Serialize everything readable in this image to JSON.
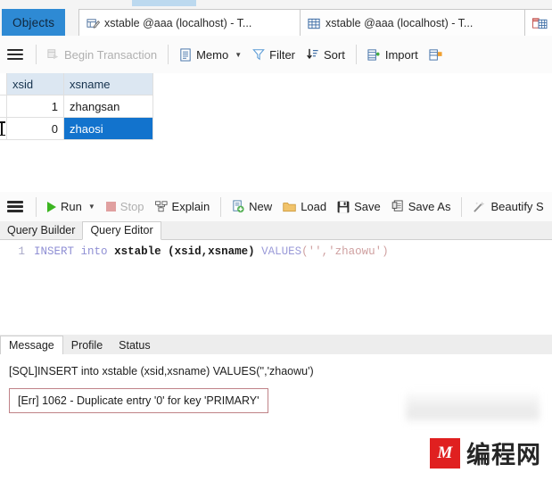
{
  "window_tabs": {
    "objects_label": "Objects",
    "tabs": [
      {
        "label": "xstable @aaa (localhost) - T...",
        "icon": "query-pencil-icon"
      },
      {
        "label": "xstable @aaa (localhost) - T...",
        "icon": "table-grid-icon"
      },
      {
        "label": "",
        "icon": "table-design-icon"
      }
    ]
  },
  "grid_toolbar": {
    "menu_icon": "hamburger-icon",
    "begin_transaction": "Begin Transaction",
    "memo": "Memo",
    "filter": "Filter",
    "sort": "Sort",
    "import": "Import"
  },
  "grid": {
    "columns": [
      "xsid",
      "xsname"
    ],
    "rows": [
      {
        "xsid": "1",
        "xsname": "zhangsan",
        "selected": false
      },
      {
        "xsid": "0",
        "xsname": "zhaosi",
        "selected": true
      }
    ],
    "selection_color": "#1273cd",
    "header_color": "#dce7f2"
  },
  "query_toolbar": {
    "menu_icon": "hamburger-icon",
    "run": "Run",
    "stop": "Stop",
    "explain": "Explain",
    "new": "New",
    "load": "Load",
    "save": "Save",
    "save_as": "Save As",
    "beautify": "Beautify S"
  },
  "query_tabs": {
    "builder": "Query Builder",
    "editor": "Query Editor",
    "active": "Query Editor"
  },
  "sql": {
    "line_number": "1",
    "kw_insert": "INSERT",
    "kw_into": "into",
    "table": "xstable",
    "columns": "(xsid,xsname)",
    "kw_values": "VALUES",
    "value_args": "('','zhaowu')",
    "full_text": "INSERT into xstable (xsid,xsname) VALUES('','zhaowu')"
  },
  "result_tabs": {
    "items": [
      "Message",
      "Profile",
      "Status"
    ],
    "active": "Message"
  },
  "message": {
    "sql_echo": "[SQL]INSERT into xstable (xsid,xsname) VALUES('','zhaowu')",
    "error": "[Err] 1062 - Duplicate entry '0' for key 'PRIMARY'",
    "error_border_color": "#c08287"
  },
  "watermark": {
    "logo_text": "M",
    "text": "编程网",
    "logo_color": "#e02020"
  }
}
